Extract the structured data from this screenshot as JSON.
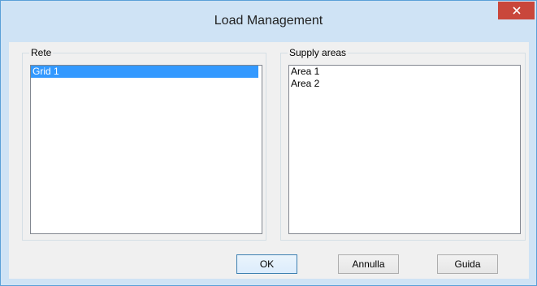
{
  "window": {
    "title": "Load Management",
    "close_icon": "close-icon"
  },
  "rete": {
    "label": "Rete",
    "items": [
      {
        "label": "Grid 1",
        "selected": true
      }
    ]
  },
  "supply_areas": {
    "label": "Supply areas",
    "items": [
      {
        "label": "Area 1",
        "selected": false
      },
      {
        "label": "Area 2",
        "selected": false
      }
    ]
  },
  "buttons": {
    "ok": "OK",
    "cancel": "Annulla",
    "help": "Guida"
  },
  "colors": {
    "titlebar": "#cfe3f5",
    "close_button": "#c9473b",
    "selection": "#3399ff"
  }
}
